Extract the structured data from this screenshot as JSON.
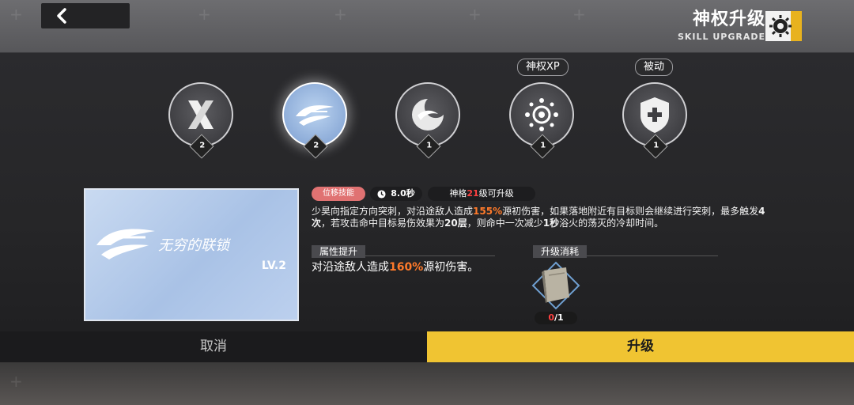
{
  "header": {
    "title": "神权升级",
    "subtitle": "SKILL UPGRADE",
    "accent": "#e8b21e"
  },
  "skills": [
    {
      "icon": "x-slash-icon",
      "level": "2",
      "selected": false,
      "tag": ""
    },
    {
      "icon": "chain-dash-icon",
      "level": "2",
      "selected": true,
      "tag": ""
    },
    {
      "icon": "crescent-swirl-icon",
      "level": "1",
      "selected": false,
      "tag": ""
    },
    {
      "icon": "burst-sun-icon",
      "level": "1",
      "selected": false,
      "tag": "神权XP"
    },
    {
      "icon": "shield-plus-icon",
      "level": "1",
      "selected": false,
      "tag": "被动"
    }
  ],
  "card": {
    "name": "无穷的联锁",
    "level": "LV.2"
  },
  "detail": {
    "type_tag": "位移技能",
    "cooldown": "8.0秒",
    "requirement_prefix": "神格",
    "requirement_level": "21",
    "requirement_suffix": "级可升级",
    "desc_1": "少昊向指定方向突刺，对沿途敌人造成",
    "desc_pct": "155%",
    "desc_2": "源初伤害，如果落地附近有目标则会继续进行突刺，最多触发",
    "desc_times": "4次",
    "desc_3": "，若攻击命中目标易伤效果为",
    "desc_layers": "20层",
    "desc_4": "，则命中一次减少",
    "desc_sec": "1秒",
    "desc_5": "浴火的荡灭的冷却时间。"
  },
  "attribute": {
    "label": "属性提升",
    "text_1": "对沿途敌人造成",
    "pct": "160%",
    "text_2": "源初伤害。"
  },
  "cost": {
    "label": "升级消耗",
    "have": "0",
    "need": "/1"
  },
  "buttons": {
    "cancel": "取消",
    "upgrade": "升级"
  }
}
